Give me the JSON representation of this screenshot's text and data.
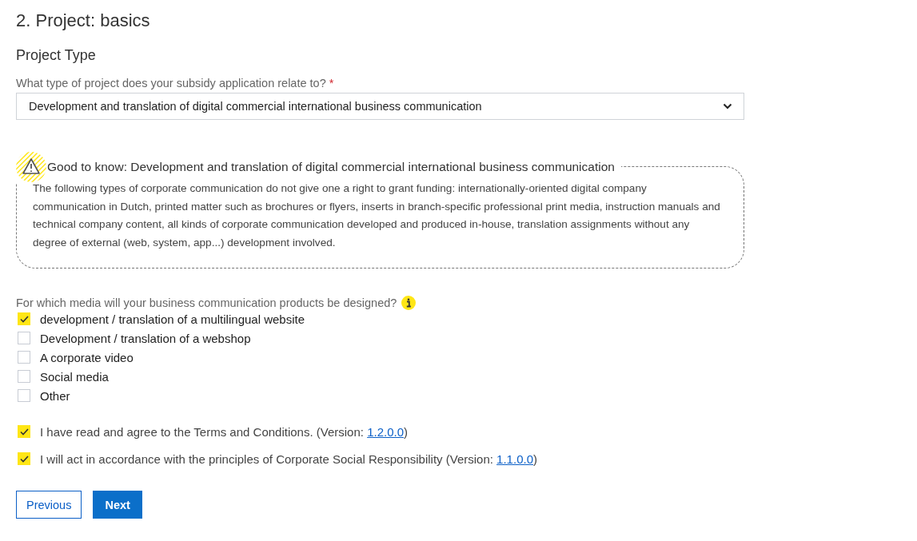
{
  "heading": "2. Project: basics",
  "section_title": "Project Type",
  "project_type": {
    "label": "What type of project does your subsidy application relate to?",
    "required_mark": "*",
    "value": "Development and translation of digital commercial international business communication"
  },
  "notice": {
    "title": "Good to know: Development and translation of digital commercial international business communication",
    "body": "The following types of corporate communication do not give one a right to grant funding: internationally-oriented digital company communication in Dutch, printed matter such as brochures or flyers, inserts in branch-specific professional print media, instruction manuals and technical company content, all kinds of corporate communication developed and produced in-house, translation assignments without any degree of external (web, system, app...) development involved."
  },
  "media": {
    "label": "For which media will your business communication products be designed?",
    "options": [
      {
        "label": "development / translation of a multilingual website",
        "checked": true
      },
      {
        "label": "Development / translation of a webshop",
        "checked": false
      },
      {
        "label": "A corporate video",
        "checked": false
      },
      {
        "label": "Social media",
        "checked": false
      },
      {
        "label": "Other",
        "checked": false
      }
    ]
  },
  "consents": [
    {
      "text": "I have read and agree to the Terms and Conditions. (Version: ",
      "link": "1.2.0.0",
      "suffix": ")",
      "checked": true
    },
    {
      "text": "I will act in accordance with the principles of Corporate Social Responsibility (Version: ",
      "link": "1.1.0.0",
      "suffix": ")",
      "checked": true
    }
  ],
  "buttons": {
    "previous": "Previous",
    "next": "Next"
  }
}
